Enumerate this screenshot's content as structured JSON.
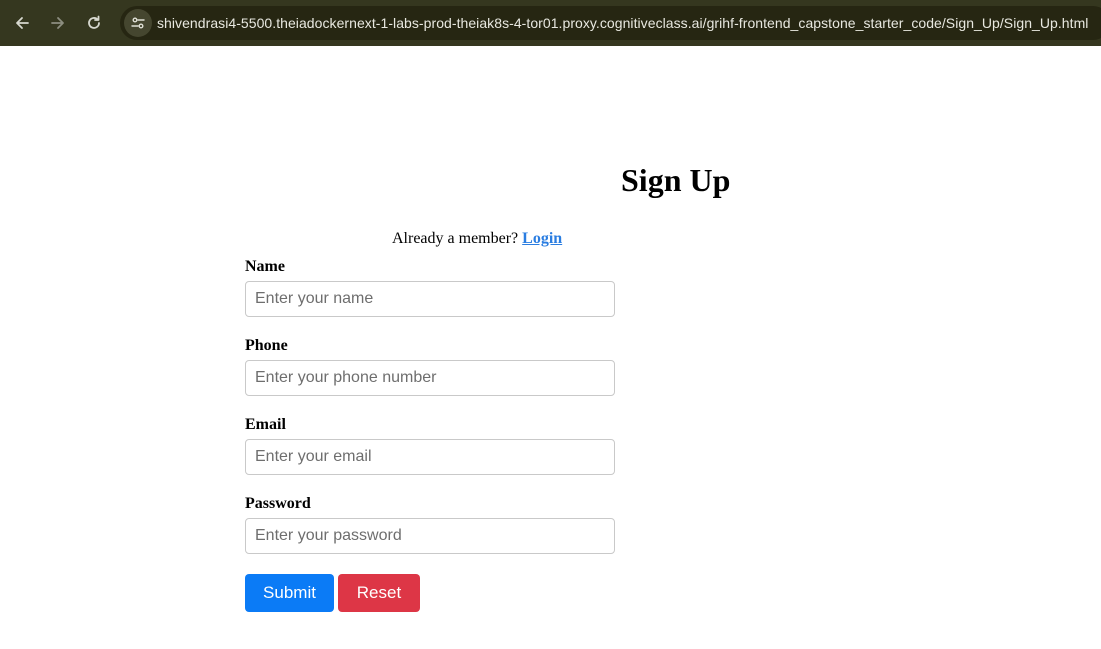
{
  "browser": {
    "url": "shivendrasi4-5500.theiadockernext-1-labs-prod-theiak8s-4-tor01.proxy.cognitiveclass.ai/grihf-frontend_capstone_starter_code/Sign_Up/Sign_Up.html",
    "toolbar_color": "#35371f",
    "omnibox_color": "#262612"
  },
  "page": {
    "title": "Sign Up",
    "member_prompt": "Already a member?",
    "login_link": "Login",
    "link_color": "#2a7de1"
  },
  "form": {
    "fields": [
      {
        "label": "Name",
        "placeholder": "Enter your name",
        "value": ""
      },
      {
        "label": "Phone",
        "placeholder": "Enter your phone number",
        "value": ""
      },
      {
        "label": "Email",
        "placeholder": "Enter your email",
        "value": ""
      },
      {
        "label": "Password",
        "placeholder": "Enter your password",
        "value": ""
      }
    ],
    "submit_label": "Submit",
    "reset_label": "Reset",
    "submit_color": "#0b7bf6",
    "reset_color": "#dd3646"
  },
  "icons": {
    "back": "arrow-left-icon",
    "forward": "arrow-right-icon",
    "reload": "reload-icon",
    "site_info": "site-settings-icon"
  }
}
